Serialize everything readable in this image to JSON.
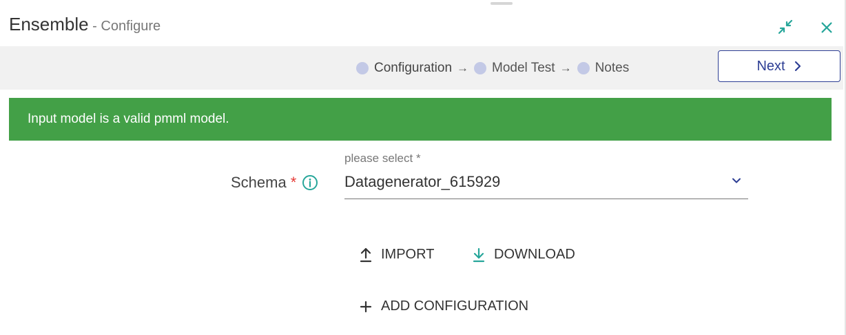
{
  "window": {
    "title": "Ensemble",
    "separator": " - ",
    "subtitle": "Configure"
  },
  "stepper": {
    "steps": [
      {
        "label": "Configuration",
        "active": true
      },
      {
        "label": "Model Test",
        "active": false
      },
      {
        "label": "Notes",
        "active": false
      }
    ],
    "arrow": "→",
    "next_label": "Next"
  },
  "alert": {
    "message": "Input model is a valid pmml model.",
    "color": "#43a047"
  },
  "schema": {
    "label": "Schema",
    "required_mark": "*",
    "hint": "please select *",
    "value": "Datagenerator_615929"
  },
  "actions": {
    "import_label": "IMPORT",
    "download_label": "DOWNLOAD",
    "add_label": "ADD CONFIGURATION"
  },
  "colors": {
    "accent_teal": "#26a69a",
    "primary_blue": "#2d3e94",
    "required_red": "#e53935"
  },
  "icons": [
    "minimize-icon",
    "close-icon",
    "chevron-right-icon",
    "info-icon",
    "chevron-down-icon",
    "upload-icon",
    "download-icon",
    "plus-icon"
  ]
}
